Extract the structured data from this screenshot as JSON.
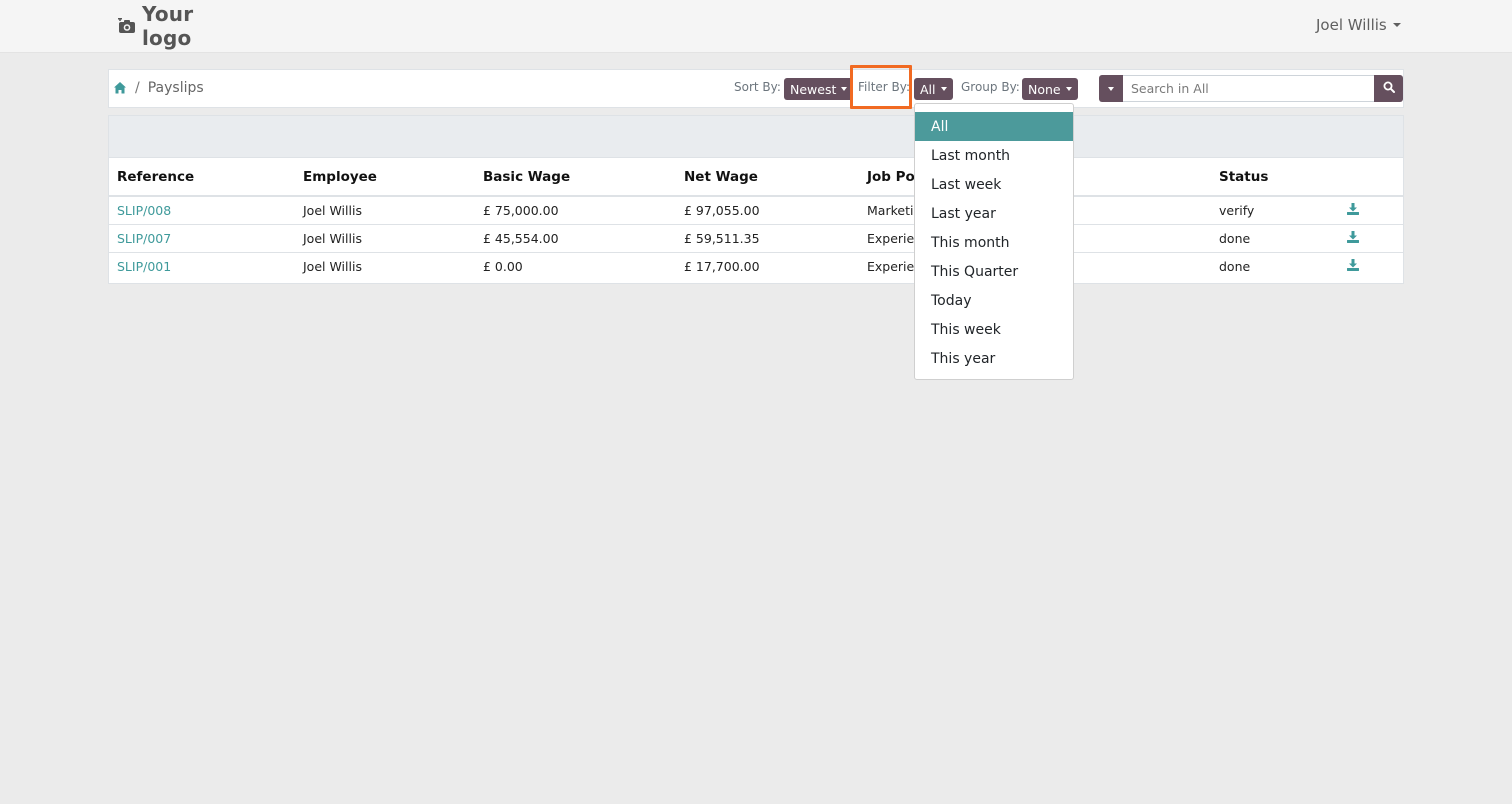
{
  "header": {
    "logo_text": "Your logo",
    "user_name": "Joel Willis"
  },
  "breadcrumb": {
    "separator": "/",
    "current": "Payslips"
  },
  "controls": {
    "sort_label": "Sort By:",
    "sort_value": "Newest",
    "filter_label": "Filter By:",
    "filter_value": "All",
    "group_label": "Group By:",
    "group_value": "None",
    "search_placeholder": "Search in All"
  },
  "table": {
    "headers": [
      "Reference",
      "Employee",
      "Basic Wage",
      "Net Wage",
      "Job Pos",
      "Status"
    ],
    "rows": [
      {
        "reference": "SLIP/008",
        "employee": "Joel Willis",
        "basic": "£ 75,000.00",
        "net": "£ 97,055.00",
        "job": "Marketin",
        "status": "verify"
      },
      {
        "reference": "SLIP/007",
        "employee": "Joel Willis",
        "basic": "£ 45,554.00",
        "net": "£ 59,511.35",
        "job": "Experien",
        "status": "done"
      },
      {
        "reference": "SLIP/001",
        "employee": "Joel Willis",
        "basic": "£ 0.00",
        "net": "£ 17,700.00",
        "job": "Experien",
        "status": "done"
      }
    ]
  },
  "filter_menu": {
    "items": [
      "All",
      "Last month",
      "Last week",
      "Last year",
      "This month",
      "This Quarter",
      "Today",
      "This week",
      "This year"
    ],
    "selected": "All"
  },
  "colors": {
    "brand_button": "#654f5e",
    "link": "#3f9a9b",
    "active_item": "#4c9a9b",
    "highlight": "#f16a22"
  }
}
